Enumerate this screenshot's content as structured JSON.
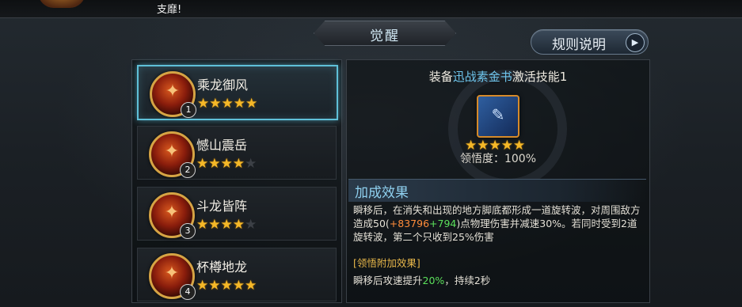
{
  "header": {
    "notice_text": "支靡!",
    "title": "觉醒",
    "rules_button": "规则说明",
    "rules_arrow": "▶"
  },
  "skills": [
    {
      "name": "乘龙御风",
      "index": "1",
      "stars_on": 5,
      "selected": true
    },
    {
      "name": "憾山震岳",
      "index": "2",
      "stars_on": 4,
      "selected": false
    },
    {
      "name": "斗龙皆阵",
      "index": "3",
      "stars_on": 4,
      "selected": false
    },
    {
      "name": "杯樽地龙",
      "index": "4",
      "stars_on": 5,
      "selected": false
    }
  ],
  "max_stars": 5,
  "detail": {
    "equip_prefix": "装备",
    "equip_item": "迅战素金书",
    "equip_suffix": "激活技能1",
    "item_stars": 5,
    "comprehension": "领悟度：100%",
    "effect_title": "加成效果",
    "effect_part1": "瞬移后，在消失和出现的地方脚底都形成一道旋转波，对周围敌方造成50(",
    "effect_bonus1": "+83796",
    "effect_bonus2": "+794",
    "effect_part2": ")点物理伤害并减速30%。若同时受到2道旋转波，第二个只收到25%伤害",
    "bonus_title": "[领悟附加效果]",
    "bonus_part1": "瞬移后攻速提升",
    "bonus_value": "20%",
    "bonus_part2": "，持续2秒"
  },
  "icons": {
    "skill_glyph": "✦",
    "book_glyph": "✎",
    "star_glyph": "★"
  },
  "colors": {
    "accent": "#5fc0d8",
    "star": "#f5b828",
    "highlight_blue": "#6fc6ee",
    "bonus_orange": "#ff8c3a",
    "bonus_green": "#5be05b"
  }
}
